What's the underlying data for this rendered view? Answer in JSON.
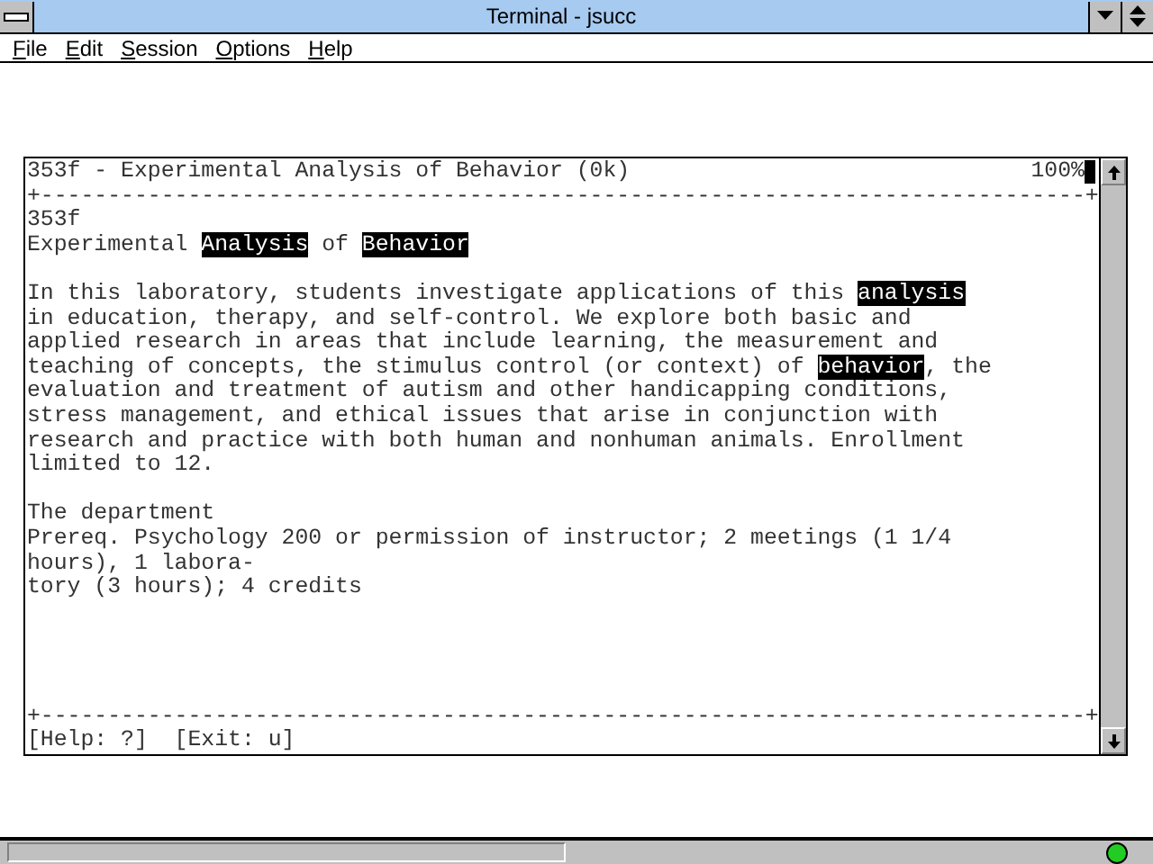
{
  "window": {
    "title": "Terminal - jsucc"
  },
  "menu": [
    "File",
    "Edit",
    "Session",
    "Options",
    "Help"
  ],
  "terminal": {
    "header_title": "353f - Experimental Analysis of Behavior (0k)",
    "header_percent": "100%",
    "top_rule": "+------------------------------------------------------------------------------+",
    "blocks": [
      [
        [
          {
            "text": "353f",
            "highlighted": false
          }
        ],
        [
          {
            "text": "Experimental ",
            "highlighted": false
          },
          {
            "text": "Analysis",
            "highlighted": true
          },
          {
            "text": " of ",
            "highlighted": false
          },
          {
            "text": "Behavior",
            "highlighted": true
          }
        ]
      ],
      [
        [
          {
            "text": "In this laboratory, students investigate applications of this ",
            "highlighted": false
          },
          {
            "text": "analysis",
            "highlighted": true
          }
        ],
        [
          {
            "text": "in education, therapy, and self-control. We explore both basic and",
            "highlighted": false
          }
        ],
        [
          {
            "text": "applied research in areas that include learning, the measurement and",
            "highlighted": false
          }
        ],
        [
          {
            "text": "teaching of concepts, the stimulus control (or context) of ",
            "highlighted": false
          },
          {
            "text": "behavior",
            "highlighted": true
          },
          {
            "text": ", the",
            "highlighted": false
          }
        ],
        [
          {
            "text": "evaluation and treatment of autism and other handicapping conditions,",
            "highlighted": false
          }
        ],
        [
          {
            "text": "stress management, and ethical issues that arise in conjunction with",
            "highlighted": false
          }
        ],
        [
          {
            "text": "research and practice with both human and nonhuman animals. Enrollment",
            "highlighted": false
          }
        ],
        [
          {
            "text": "limited to 12.",
            "highlighted": false
          }
        ]
      ],
      [
        [
          {
            "text": "The department",
            "highlighted": false
          }
        ],
        [
          {
            "text": "Prereq. Psychology 200 or permission of instructor; 2 meetings (1 1/4",
            "highlighted": false
          }
        ],
        [
          {
            "text": "hours), 1 labora-",
            "highlighted": false
          }
        ],
        [
          {
            "text": "tory (3 hours); 4 credits",
            "highlighted": false
          }
        ]
      ]
    ],
    "bottom_rule": "+------------------------------------------------------------------------------+",
    "footer": "[Help: ?]  [Exit: u]"
  }
}
